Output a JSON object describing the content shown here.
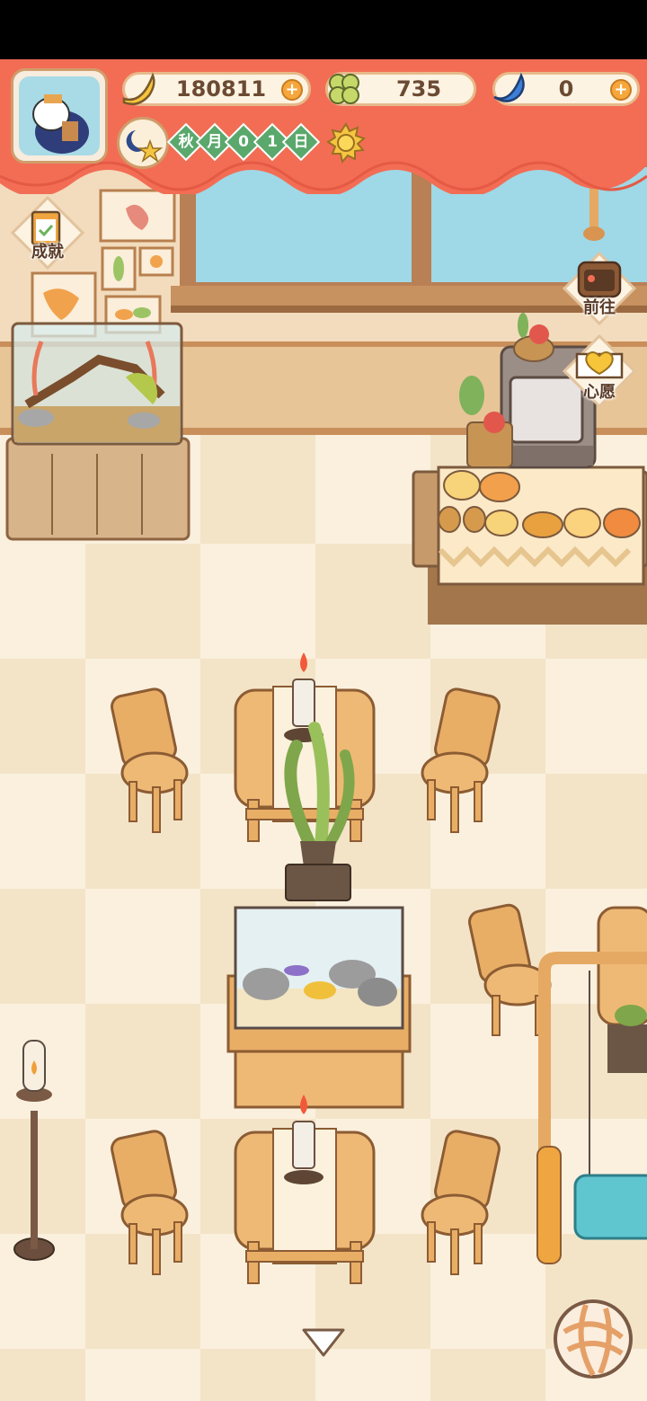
{
  "currencies": {
    "banana": {
      "value": "180811",
      "icon": "banana-icon"
    },
    "clover": {
      "value": "735",
      "icon": "clover-icon"
    },
    "gem": {
      "value": "0",
      "icon": "blue-gem-icon"
    }
  },
  "date": {
    "chars": [
      "秋",
      "月",
      "0",
      "1",
      "日"
    ]
  },
  "side_buttons": {
    "achievements": "成就",
    "go": "前往",
    "wish": "心愿"
  },
  "colors": {
    "banner": "#f36d55",
    "floor": "#fbf0de",
    "wall": "#f2dcbd",
    "window": "#9fd8e6",
    "wood": "#e5a963"
  }
}
